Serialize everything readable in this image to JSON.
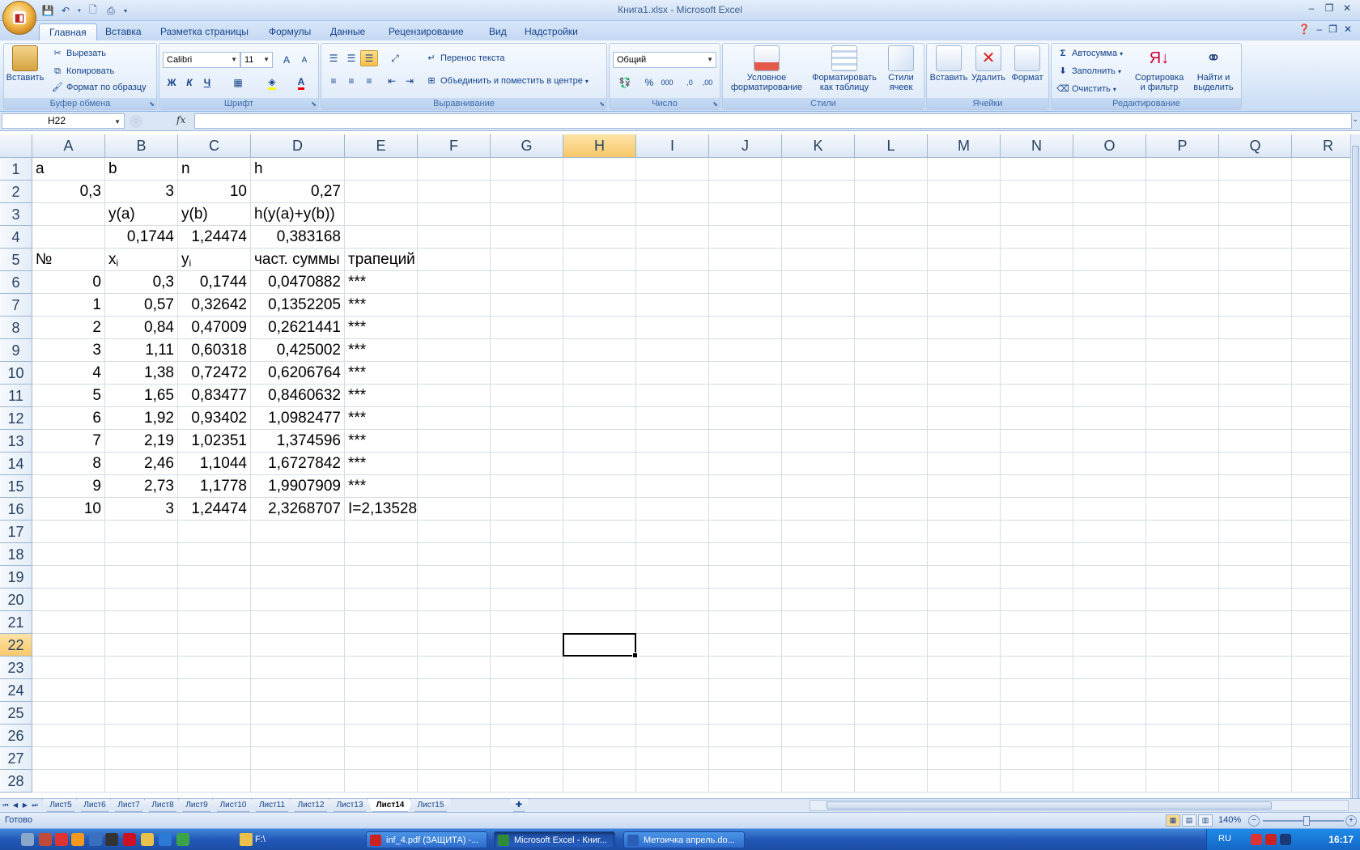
{
  "window": {
    "title": "Книга1.xlsx - Microsoft Excel"
  },
  "qat": {
    "save_icon": "save-icon",
    "undo_icon": "undo-icon"
  },
  "tabs": [
    "Главная",
    "Вставка",
    "Разметка страницы",
    "Формулы",
    "Данные",
    "Рецензирование",
    "Вид",
    "Надстройки"
  ],
  "ribbon": {
    "clipboard": {
      "group": "Буфер обмена",
      "paste": "Вставить",
      "cut": "Вырезать",
      "copy": "Копировать",
      "format_painter": "Формат по образцу"
    },
    "font": {
      "group": "Шрифт",
      "name": "Calibri",
      "size": "11",
      "bold": "Ж",
      "italic": "К",
      "underline": "Ч",
      "grow": "A",
      "shrink": "A",
      "color_letter": "A"
    },
    "alignment": {
      "group": "Выравнивание",
      "wrap": "Перенос текста",
      "merge": "Объединить и поместить в центре"
    },
    "number": {
      "group": "Число",
      "format": "Общий",
      "percent": "%",
      "thousands": "000",
      "inc_dec": ",0",
      "dec_dec": ",00"
    },
    "styles": {
      "group": "Стили",
      "conditional": "Условное",
      "conditional2": "форматирование",
      "as_table": "Форматировать",
      "as_table2": "как таблицу",
      "cell_styles": "Стили",
      "cell_styles2": "ячеек"
    },
    "cells": {
      "group": "Ячейки",
      "insert": "Вставить",
      "delete": "Удалить",
      "format": "Формат"
    },
    "editing": {
      "group": "Редактирование",
      "autosum": "Автосумма",
      "fill": "Заполнить",
      "clear": "Очистить",
      "sort": "Сортировка",
      "sort2": "и фильтр",
      "find": "Найти и",
      "find2": "выделить"
    }
  },
  "formula_bar": {
    "name_box": "H22",
    "fx": "fx",
    "value": ""
  },
  "columns": [
    "A",
    "B",
    "C",
    "D",
    "E",
    "F",
    "G",
    "H",
    "I",
    "J",
    "K",
    "L",
    "M",
    "N",
    "O",
    "P",
    "Q",
    "R"
  ],
  "rows": [
    "1",
    "2",
    "3",
    "4",
    "5",
    "6",
    "7",
    "8",
    "9",
    "10",
    "11",
    "12",
    "13",
    "14",
    "15",
    "16",
    "17",
    "18",
    "19",
    "20",
    "21",
    "22",
    "23",
    "24",
    "25",
    "26",
    "27",
    "28"
  ],
  "cells": {
    "r1": [
      "a",
      "b",
      "n",
      "h",
      ""
    ],
    "r2": [
      "0,3",
      "3",
      "10",
      "0,27",
      ""
    ],
    "r3": [
      "",
      "y(a)",
      "y(b)",
      "h(y(a)+y(b))",
      ""
    ],
    "r4": [
      "",
      "0,1744",
      "1,24474",
      "0,383168",
      ""
    ],
    "r5": {
      "a": "№",
      "b_main": "x",
      "b_sub": "i",
      "c_main": "y",
      "c_sub": "i",
      "d": "част. суммы",
      "e": "трапеций"
    },
    "r6": [
      "0",
      "0,3",
      "0,1744",
      "0,0470882",
      "***"
    ],
    "r7": [
      "1",
      "0,57",
      "0,32642",
      "0,1352205",
      "***"
    ],
    "r8": [
      "2",
      "0,84",
      "0,47009",
      "0,2621441",
      "***"
    ],
    "r9": [
      "3",
      "1,11",
      "0,60318",
      "0,425002",
      "***"
    ],
    "r10": [
      "4",
      "1,38",
      "0,72472",
      "0,6206764",
      "***"
    ],
    "r11": [
      "5",
      "1,65",
      "0,83477",
      "0,8460632",
      "***"
    ],
    "r12": [
      "6",
      "1,92",
      "0,93402",
      "1,0982477",
      "***"
    ],
    "r13": [
      "7",
      "2,19",
      "1,02351",
      "1,374596",
      "***"
    ],
    "r14": [
      "8",
      "2,46",
      "1,1044",
      "1,6727842",
      "***"
    ],
    "r15": [
      "9",
      "2,73",
      "1,1778",
      "1,9907909",
      "***"
    ],
    "r16": [
      "10",
      "3",
      "1,24474",
      "2,3268707",
      "I=2,13528"
    ]
  },
  "active_cell": "H22",
  "sheets": [
    "Лист5",
    "Лист6",
    "Лист7",
    "Лист8",
    "Лист9",
    "Лист10",
    "Лист11",
    "Лист12",
    "Лист13",
    "Лист14",
    "Лист15"
  ],
  "active_sheet": "Лист14",
  "status": {
    "ready": "Готово",
    "zoom": "140%"
  },
  "taskbar": {
    "items": [
      "inf_4.pdf (ЗАЩИТА) -...",
      "Microsoft Excel - Книг...",
      "Метоичка апрель.do..."
    ],
    "folder": "F:\\",
    "lang": "RU",
    "clock": "16:17"
  },
  "colors": {
    "accent": "#15428b",
    "selected_header": "#f8c86a"
  }
}
